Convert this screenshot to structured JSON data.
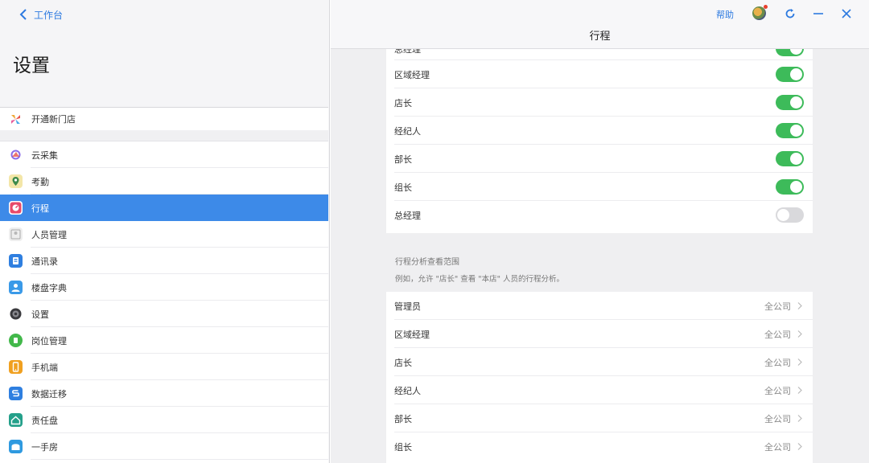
{
  "left": {
    "back_label": "工作台",
    "title": "设置",
    "items": [
      {
        "label": "开通新门店",
        "icon": "pinwheel-icon"
      },
      {
        "label": "云采集",
        "icon": "cloud-collect-icon"
      },
      {
        "label": "考勤",
        "icon": "attendance-icon"
      },
      {
        "label": "行程",
        "icon": "itinerary-icon",
        "active": true
      },
      {
        "label": "人员管理",
        "icon": "people-icon"
      },
      {
        "label": "通讯录",
        "icon": "contacts-icon"
      },
      {
        "label": "楼盘字典",
        "icon": "building-dict-icon"
      },
      {
        "label": "设置",
        "icon": "settings-icon"
      },
      {
        "label": "岗位管理",
        "icon": "position-icon"
      },
      {
        "label": "手机端",
        "icon": "mobile-icon"
      },
      {
        "label": "数据迁移",
        "icon": "data-migrate-icon"
      },
      {
        "label": "责任盘",
        "icon": "responsibility-icon"
      },
      {
        "label": "一手房",
        "icon": "new-house-icon"
      }
    ]
  },
  "topbar": {
    "title": "行程",
    "help_label": "帮助"
  },
  "toggles": [
    {
      "label": "总经理",
      "on": true,
      "partial": true
    },
    {
      "label": "区域经理",
      "on": true
    },
    {
      "label": "店长",
      "on": true
    },
    {
      "label": "经纪人",
      "on": true
    },
    {
      "label": "部长",
      "on": true
    },
    {
      "label": "组长",
      "on": true
    },
    {
      "label": "总经理",
      "on": false
    }
  ],
  "scope_section": {
    "title": "行程分析查看范围",
    "description": "例如，允许 \"店长\" 查看 \"本店\" 人员的行程分析。",
    "rows": [
      {
        "label": "管理员",
        "value": "全公司"
      },
      {
        "label": "区域经理",
        "value": "全公司"
      },
      {
        "label": "店长",
        "value": "全公司"
      },
      {
        "label": "经纪人",
        "value": "全公司"
      },
      {
        "label": "部长",
        "value": "全公司"
      },
      {
        "label": "组长",
        "value": "全公司"
      }
    ]
  },
  "colors": {
    "accent": "#3d8ae8",
    "toggle_on": "#3dbb5a",
    "toggle_off": "#d9d9dc",
    "link": "#2d7ae0"
  }
}
